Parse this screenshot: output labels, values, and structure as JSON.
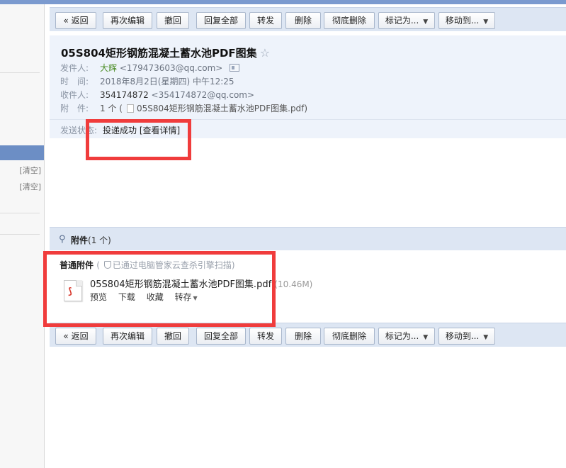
{
  "toolbar": {
    "back": "« 返回",
    "edit_again": "再次编辑",
    "recall": "撤回",
    "reply_all": "回复全部",
    "forward": "转发",
    "delete": "删除",
    "delete_perm": "彻底删除",
    "mark_as": "标记为...",
    "move_to": "移动到..."
  },
  "sidebar": {
    "clear1": "[清空]",
    "clear2": "[清空]"
  },
  "email": {
    "subject": "05S804矩形钢筋混凝土蓄水池PDF图集",
    "star": "☆",
    "sender_label": "发件人:",
    "sender_name": "大辉",
    "sender_addr": "<179473603@qq.com>",
    "time_label": "时　间:",
    "time": "2018年8月2日(星期四) 中午12:25",
    "to_label": "收件人:",
    "to_name": "354174872",
    "to_addr": "<354174872@qq.com>",
    "att_label": "附　件:",
    "att_summary_count": "1 个 (",
    "att_summary_name": "05S804矩形钢筋混凝土蓄水池PDF图集.pdf)",
    "status_label": "发送状态:",
    "status_value": "投递成功 [查看详情]"
  },
  "attachments": {
    "title": "附件",
    "count": "(1 个)",
    "type": "普通附件",
    "safe_note": "已通过电脑管家云查杀引擎扫描)",
    "safe_prefix": "(",
    "file_name": "05S804矩形钢筋混凝土蓄水池PDF图集.pdf",
    "file_size": "(10.46M)",
    "preview": "预览",
    "download": "下载",
    "favorite": "收藏",
    "save_to": "转存"
  },
  "icons": {
    "attachment": "paperclip-icon",
    "pdf": "pdf-file-icon",
    "shield": "shield-icon",
    "contact": "contact-card-icon"
  },
  "colors": {
    "accent": "#7b9acf",
    "toolbar_bg": "#dde6f3",
    "header_bg": "#eef3fb",
    "highlight": "#f03c3c",
    "sender": "#4f8f2a"
  }
}
